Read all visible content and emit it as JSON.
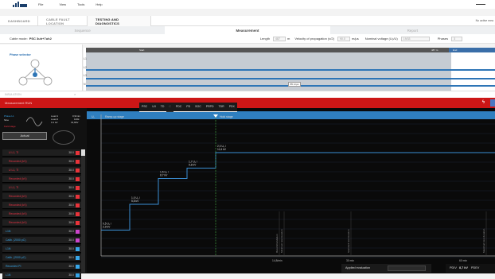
{
  "menu": [
    "File",
    "View",
    "Tools",
    "Help"
  ],
  "tabs": {
    "items": [
      "DASHBOARD",
      "CABLE FAULT LOCATION",
      "TESTING AND DIAGNOSTICS"
    ],
    "right": "No active mea"
  },
  "steps": [
    "Sequence",
    "Measurement",
    "Report"
  ],
  "params": {
    "cable_mode_label": "Cable mode:",
    "cable_mode_value": "PSC 3uh+7uh2",
    "length_label": "Length",
    "length_value": "487",
    "length_unit": "m",
    "velocity_label": "Velocity of propagation (v/2)",
    "velocity_value": "90.0",
    "velocity_unit": "m/µs",
    "nominal_label": "Nominal voltage (U₀/U)",
    "nominal_value": "19/33",
    "phases_label": "Phases",
    "phases_value": "3"
  },
  "phase_selector": {
    "title": "Phase selector",
    "labels": [
      "L1",
      "L2",
      "L3",
      "N"
    ]
  },
  "waveform": {
    "start_label": "Start",
    "end_label": "487 m",
    "end_tag": "End",
    "marker": "85 m/µs"
  },
  "collapse_label": "INSULATION",
  "redbar_title": "Measurement RUN",
  "left": {
    "selection": [
      "Phase L1",
      "Load 1",
      "Load 2",
      "0.1 Hz",
      "Sine",
      "-",
      "0,9/min",
      "100k",
      "31,8kV"
    ],
    "status_label": "Field stage",
    "actual_label": "Actual",
    "rows": [
      {
        "label": "U L1, TI",
        "value": "38.0",
        "color": "#e8333a",
        "blue": false
      },
      {
        "label": "Recorded (kV)",
        "value": "38.0",
        "color": "#e8333a",
        "blue": false
      },
      {
        "label": "U L1, TI",
        "value": "38.0",
        "color": "#e8333a",
        "blue": false
      },
      {
        "label": "Recorded (kV)",
        "value": "38.0",
        "color": "#e8333a",
        "blue": false
      },
      {
        "label": "U L1, TI",
        "value": "38.0",
        "color": "#e8333a",
        "blue": false
      },
      {
        "label": "Recorded (kV)",
        "value": "38.0",
        "color": "#e8333a",
        "blue": false
      },
      {
        "label": "Recorded (kV)",
        "value": "38.0",
        "color": "#e8333a",
        "blue": false
      },
      {
        "label": "Recorded (kV)",
        "value": "38.0",
        "color": "#e8333a",
        "blue": false
      },
      {
        "label": "Recorded (kV)",
        "value": "38.0",
        "color": "#e8333a",
        "blue": false
      },
      {
        "label": "L1N",
        "value": "38.0",
        "color": "#cc44cc",
        "blue": true
      },
      {
        "label": "Calib. (2000 pC)",
        "value": "38.0",
        "color": "#cc44cc",
        "blue": true
      },
      {
        "label": "L1N",
        "value": "38.0",
        "color": "#37a6e8",
        "blue": true
      },
      {
        "label": "Calib. (2000 pC)",
        "value": "38.0",
        "color": "#37a6e8",
        "blue": true
      },
      {
        "label": "Recorded PI",
        "value": "38.0",
        "color": "#37a6e8",
        "blue": true
      },
      {
        "label": "L1N",
        "value": "38.0",
        "color": "#37a6e8",
        "blue": true
      }
    ]
  },
  "chart_tabs": [
    "PSC",
    "U/I",
    "TD",
    "C",
    "PDC",
    "PD",
    "SOC",
    "PRPD",
    "TDR",
    "PDX"
  ],
  "chart": {
    "y_label": "U₀",
    "rampup_label": "Ramp-up stage",
    "hold_label": "Hold stage",
    "steps": [
      {
        "l1": "0,5 U₀ /",
        "l2": "2,9 kV"
      },
      {
        "l1": "1,0 U₀ /",
        "l2": "5,8 kV"
      },
      {
        "l1": "1,5 U₀ /",
        "l2": "8,7 kV"
      },
      {
        "l1": "1,7 U₀ /",
        "l2": "9,8 kV"
      },
      {
        "l1": "2,0 U₀ /",
        "l2": "11,6 kV"
      }
    ],
    "vlabels": [
      "Recommendation",
      "Minimum test duration",
      "Standard test duration",
      "Maximum test duration"
    ],
    "xticks": [
      "14,8/min",
      "30 min",
      "60 min"
    ]
  },
  "bottom": {
    "applied_label": "Applied evaluation",
    "pdiv_label": "PDIV",
    "pdiv_value": "8,7 kV",
    "pdev_label": "PDEV"
  }
}
